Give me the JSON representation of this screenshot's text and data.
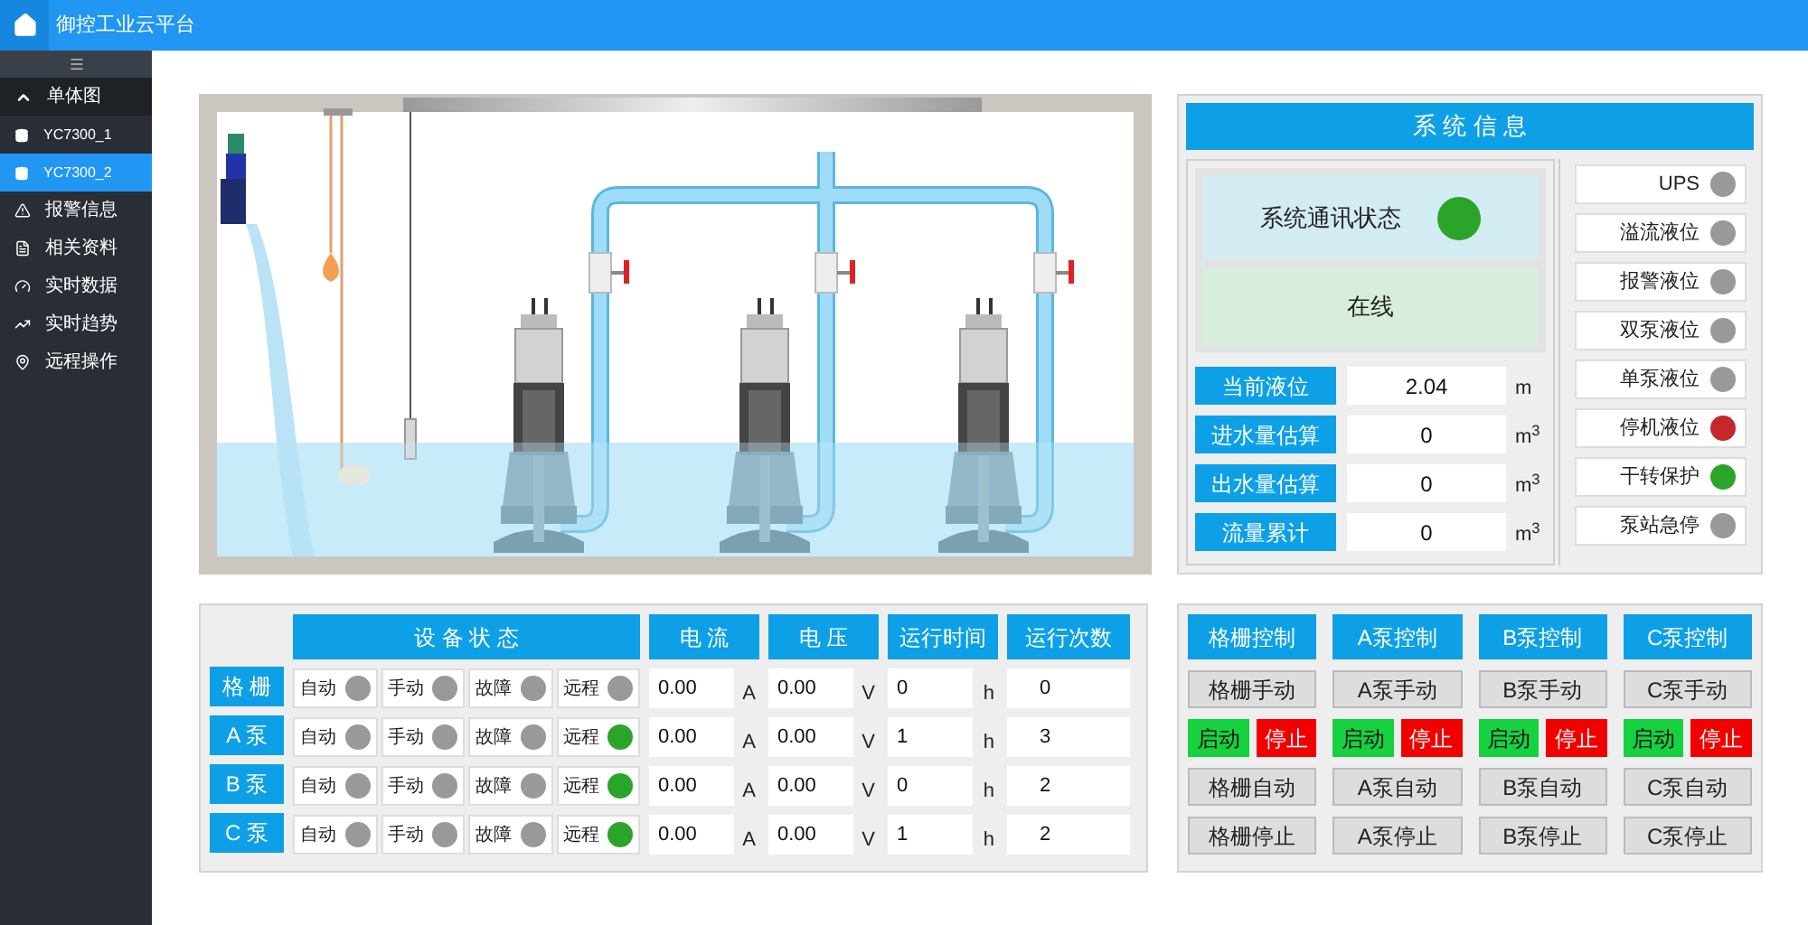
{
  "header": {
    "title": "御控工业云平台"
  },
  "sidebar": {
    "items": [
      {
        "label": "单体图",
        "expanded": true,
        "children": [
          {
            "label": "YC7300_1",
            "selected": false
          },
          {
            "label": "YC7300_2",
            "selected": true
          }
        ]
      },
      {
        "label": "报警信息",
        "selected": false
      },
      {
        "label": "相关资料",
        "selected": false
      },
      {
        "label": "实时数据",
        "selected": false
      },
      {
        "label": "实时趋势",
        "selected": false
      },
      {
        "label": "远程操作",
        "selected": false
      }
    ]
  },
  "system_info": {
    "title": "系 统 信 息",
    "comm_status": {
      "label": "系统通讯状态",
      "color": "#2aa52a"
    },
    "online": "在线",
    "measurements": [
      {
        "label": "当前液位",
        "value": "2.04",
        "unit": "m"
      },
      {
        "label": "进水量估算",
        "value": "0",
        "unit": "m$^{3}$"
      },
      {
        "label": "出水量估算",
        "value": "0",
        "unit": "m$^{3}$"
      },
      {
        "label": "流量累计",
        "value": "0",
        "unit": "m$^{3}$"
      }
    ],
    "indicators": [
      {
        "label": "UPS",
        "color": "#999999"
      },
      {
        "label": "溢流液位",
        "color": "#999999"
      },
      {
        "label": "报警液位",
        "color": "#999999"
      },
      {
        "label": "双泵液位",
        "color": "#999999"
      },
      {
        "label": "单泵液位",
        "color": "#999999"
      },
      {
        "label": "停机液位",
        "color": "#c4282a"
      },
      {
        "label": "干转保护",
        "color": "#2aa52a"
      },
      {
        "label": "泵站急停",
        "color": "#999999"
      }
    ]
  },
  "device_table": {
    "columns": [
      "设 备 状 态",
      "电 流",
      "电 压",
      "运行时间",
      "运行次数"
    ],
    "rows": [
      {
        "name": "格 栅",
        "statuses": [
          {
            "label": "自动",
            "color": "#999999"
          },
          {
            "label": "手动",
            "color": "#999999"
          },
          {
            "label": "故障",
            "color": "#999999"
          },
          {
            "label": "远程",
            "color": "#999999"
          }
        ],
        "current": "0.00",
        "current_unit": "A",
        "voltage": "0.00",
        "voltage_unit": "V",
        "run_time": "0",
        "run_time_unit": "h",
        "run_count": "0"
      },
      {
        "name": "A 泵",
        "statuses": [
          {
            "label": "自动",
            "color": "#999999"
          },
          {
            "label": "手动",
            "color": "#999999"
          },
          {
            "label": "故障",
            "color": "#999999"
          },
          {
            "label": "远程",
            "color": "#2aa52a"
          }
        ],
        "current": "0.00",
        "current_unit": "A",
        "voltage": "0.00",
        "voltage_unit": "V",
        "run_time": "1",
        "run_time_unit": "h",
        "run_count": "3"
      },
      {
        "name": "B 泵",
        "statuses": [
          {
            "label": "自动",
            "color": "#999999"
          },
          {
            "label": "手动",
            "color": "#999999"
          },
          {
            "label": "故障",
            "color": "#999999"
          },
          {
            "label": "远程",
            "color": "#2aa52a"
          }
        ],
        "current": "0.00",
        "current_unit": "A",
        "voltage": "0.00",
        "voltage_unit": "V",
        "run_time": "0",
        "run_time_unit": "h",
        "run_count": "2"
      },
      {
        "name": "C 泵",
        "statuses": [
          {
            "label": "自动",
            "color": "#999999"
          },
          {
            "label": "手动",
            "color": "#999999"
          },
          {
            "label": "故障",
            "color": "#999999"
          },
          {
            "label": "远程",
            "color": "#2aa52a"
          }
        ],
        "current": "0.00",
        "current_unit": "A",
        "voltage": "0.00",
        "voltage_unit": "V",
        "run_time": "1",
        "run_time_unit": "h",
        "run_count": "2"
      }
    ]
  },
  "controls": [
    {
      "title": "格栅控制",
      "manual": "格栅手动",
      "start": "启动",
      "stop": "停止",
      "auto": "格栅自动",
      "halt": "格栅停止"
    },
    {
      "title": "A泵控制",
      "manual": "A泵手动",
      "start": "启动",
      "stop": "停止",
      "auto": "A泵自动",
      "halt": "A泵停止"
    },
    {
      "title": "B泵控制",
      "manual": "B泵手动",
      "start": "启动",
      "stop": "停止",
      "auto": "B泵自动",
      "halt": "B泵停止"
    },
    {
      "title": "C泵控制",
      "manual": "C泵手动",
      "start": "启动",
      "stop": "停止",
      "auto": "C泵自动",
      "halt": "C泵停止"
    }
  ]
}
